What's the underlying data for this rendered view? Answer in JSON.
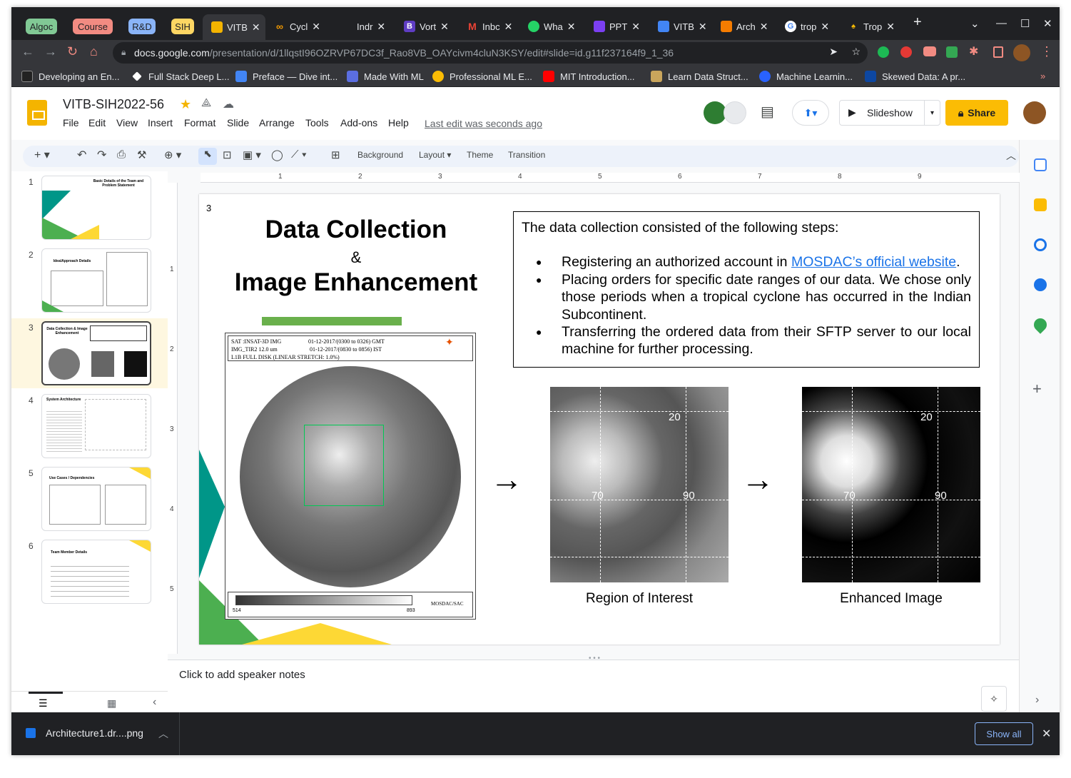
{
  "browser": {
    "tab_groups": [
      {
        "label": "Algoc",
        "color": "#81c995"
      },
      {
        "label": "Course",
        "color": "#f28b82"
      },
      {
        "label": "R&D",
        "color": "#8ab4f8"
      },
      {
        "label": "SIH",
        "color": "#fdd663"
      }
    ],
    "tabs": [
      {
        "label": "VITB",
        "active": true
      },
      {
        "label": "Cycl"
      },
      {
        "label": "Indr"
      },
      {
        "label": "Vort"
      },
      {
        "label": "Inbc"
      },
      {
        "label": "Wha"
      },
      {
        "label": "PPT"
      },
      {
        "label": "VITB"
      },
      {
        "label": "Arch"
      },
      {
        "label": "trop"
      },
      {
        "label": "Trop"
      }
    ],
    "new_tab": "+",
    "url_host": "docs.google.com",
    "url_path": "/presentation/d/1llqstI96OZRVP67DC3f_Rao8VB_OAYcivm4cluN3KSY/edit#slide=id.g11f237164f9_1_36",
    "bookmarks": [
      "Developing an En...",
      "Full Stack Deep L...",
      "Preface — Dive int...",
      "Made With ML",
      "Professional ML E...",
      "MIT Introduction...",
      "Learn Data Struct...",
      "Machine Learnin...",
      "Skewed Data: A pr..."
    ],
    "more_bookmarks": "»"
  },
  "doc": {
    "title": "VITB-SIH2022-56",
    "menus": [
      "File",
      "Edit",
      "View",
      "Insert",
      "Format",
      "Slide",
      "Arrange",
      "Tools",
      "Add-ons",
      "Help"
    ],
    "last_edit": "Last edit was seconds ago",
    "slideshow_label": "Slideshow",
    "share_label": "Share",
    "toolbar": {
      "background": "Background",
      "layout": "Layout",
      "theme": "Theme",
      "transition": "Transition"
    },
    "speaker_notes": "Click to add speaker notes"
  },
  "filmstrip": {
    "slides": [
      {
        "num": "1",
        "title": "Basic Details of the Team and Problem Statement"
      },
      {
        "num": "2",
        "title": "Idea/Approach Details"
      },
      {
        "num": "3",
        "title": "Data Collection & Image Enhancement"
      },
      {
        "num": "4",
        "title": "System Architecture"
      },
      {
        "num": "5",
        "title": "Use Cases / Dependencies"
      },
      {
        "num": "6",
        "title": "Team Member Details"
      }
    ]
  },
  "ruler": {
    "h": [
      "1",
      "2",
      "3",
      "4",
      "5",
      "6",
      "7",
      "8",
      "9"
    ],
    "v": [
      "1",
      "2",
      "3",
      "4",
      "5"
    ]
  },
  "slide": {
    "number": "3",
    "title_line1": "Data Collection",
    "title_amp": "&",
    "title_line2": "Image Enhancement",
    "intro": "The data collection consisted of the following steps:",
    "bullet1_prefix": "Registering an authorized account in ",
    "bullet1_link": "MOSDAC’s official website",
    "bullet1_suffix": ".",
    "bullet2": "Placing orders for specific date ranges of our data. We chose only those periods when a tropical cyclone has occurred in the Indian Subcontinent.",
    "bullet3": "Transferring the ordered data from their SFTP server to our local machine for further processing.",
    "sat_header_l1": "SAT :INSAT-3D IMG",
    "sat_header_r1": "01-12-2017/(0300 to 0326) GMT",
    "sat_header_l2": "IMG_TIR2 12.0 um",
    "sat_header_r2": "01-12-2017/(0830 to 0856) IST",
    "sat_header_l3": "L1B FULL DISK (LINEAR STRETCH: 1.0%)",
    "scale_min": "514",
    "scale_max": "893",
    "scale_src": "MOSDAC/SAC",
    "roi_label_20": "20",
    "roi_label_70": "70",
    "roi_label_90": "90",
    "caption1": "Region of Interest",
    "caption2": "Enhanced Image",
    "arrow": "→"
  },
  "download": {
    "file": "Architecture1.dr....png",
    "show_all": "Show all"
  }
}
